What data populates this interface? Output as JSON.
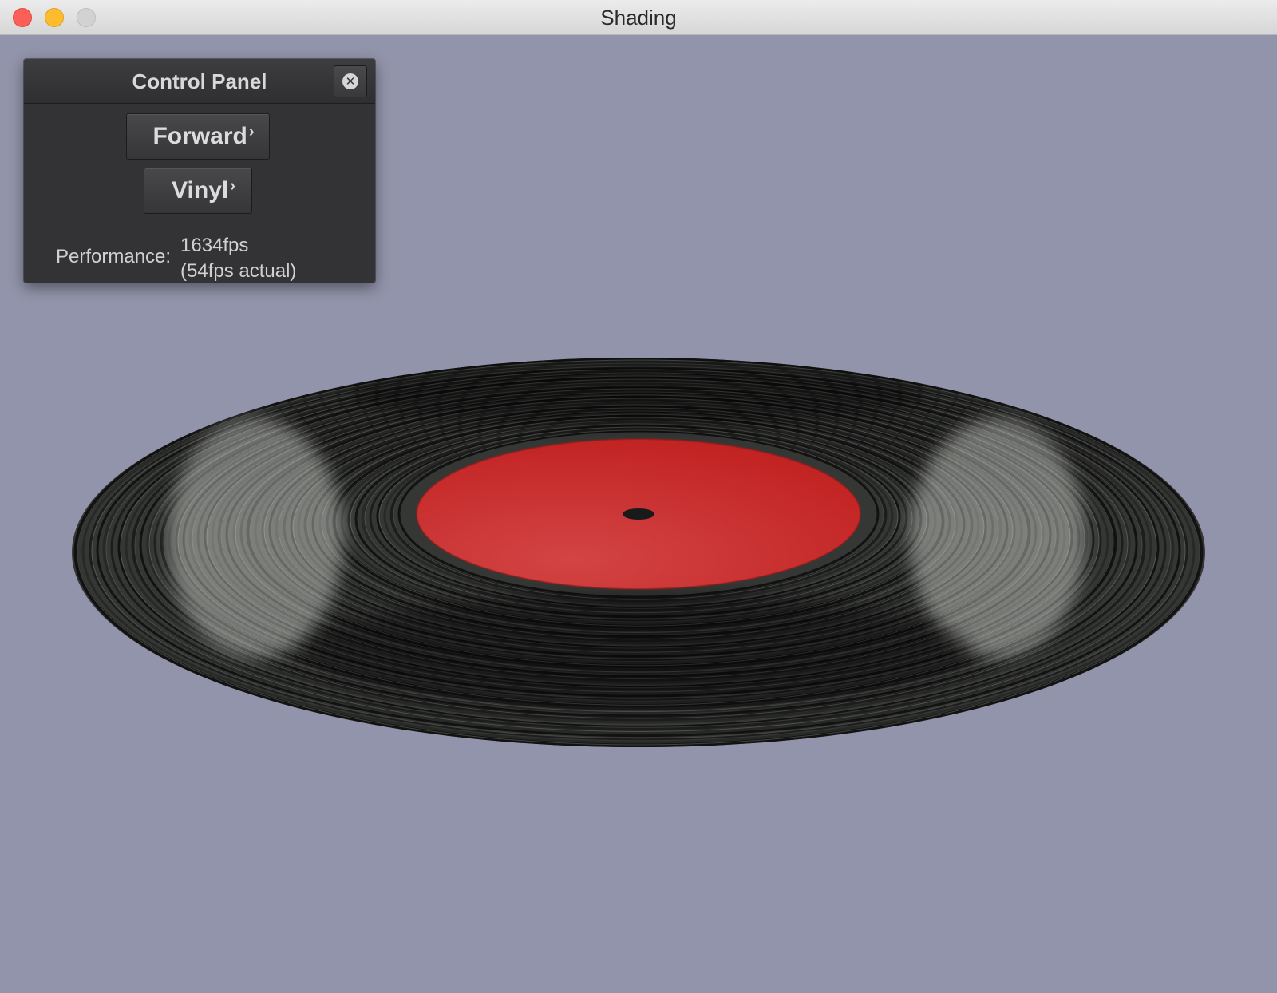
{
  "window": {
    "title": "Shading"
  },
  "control_panel": {
    "title": "Control Panel",
    "buttons": [
      {
        "label": "Forward",
        "chevron": "›"
      },
      {
        "label": "Vinyl",
        "chevron": "›"
      }
    ],
    "performance": {
      "label": "Performance:",
      "fps": "1634fps",
      "actual": "(54fps actual)"
    }
  },
  "scene": {
    "object": "vinyl record",
    "colors": {
      "background": "#9294ab",
      "vinyl": "#1b1b1b",
      "label": "#cc2a2a"
    }
  }
}
